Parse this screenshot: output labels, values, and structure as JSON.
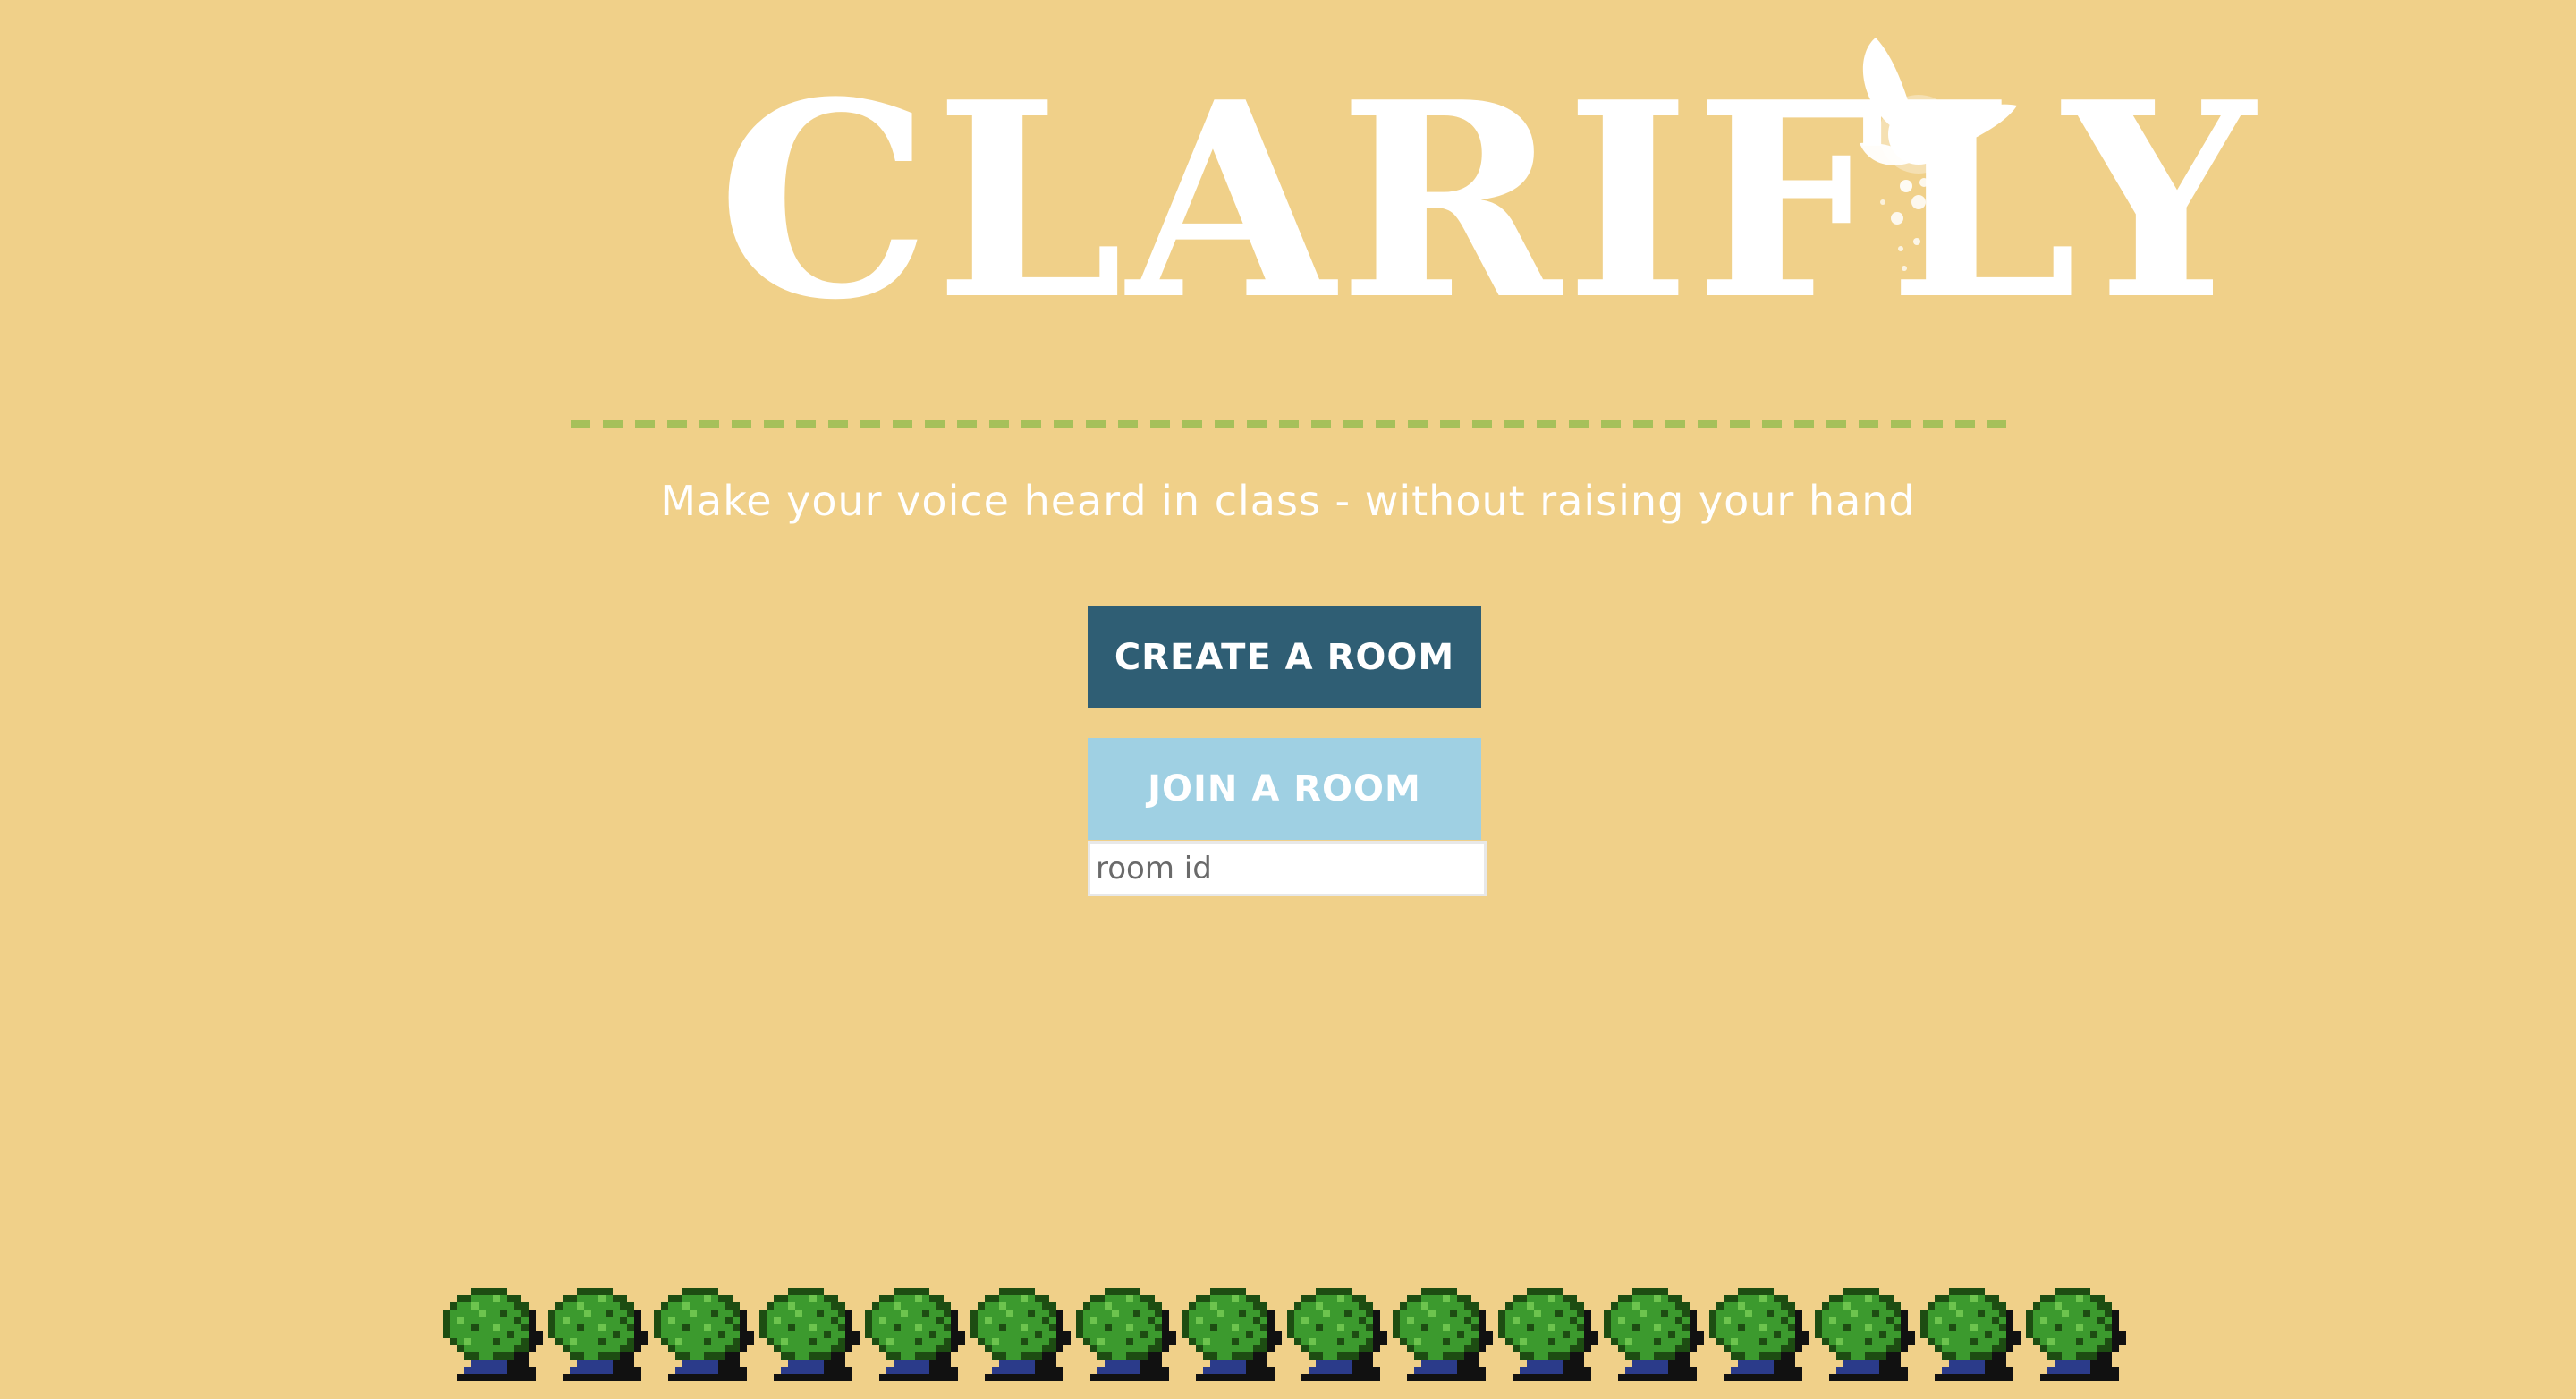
{
  "colors": {
    "background": "#f0d089",
    "divider": "#a6c05a",
    "create_button": "#2f5e74",
    "join_button": "#9fd0e3",
    "text_on_buttons": "#ffffff",
    "bush_dark": "#1d4d12",
    "bush_mid": "#3c9a2e",
    "bush_light": "#6dc44e",
    "bush_base": "#2b3b8a",
    "bush_shadow": "#111111"
  },
  "header": {
    "logo_text": "CLARIFLY",
    "logo_icon": "fairy-icon"
  },
  "tagline": "Make your voice heard in class - without raising your hand",
  "actions": {
    "create_label": "CREATE A ROOM",
    "join_label": "JOIN A ROOM",
    "room_input_placeholder": "room id",
    "room_input_value": ""
  },
  "footer": {
    "decoration_icon": "bush-icon",
    "bush_count": 16
  }
}
